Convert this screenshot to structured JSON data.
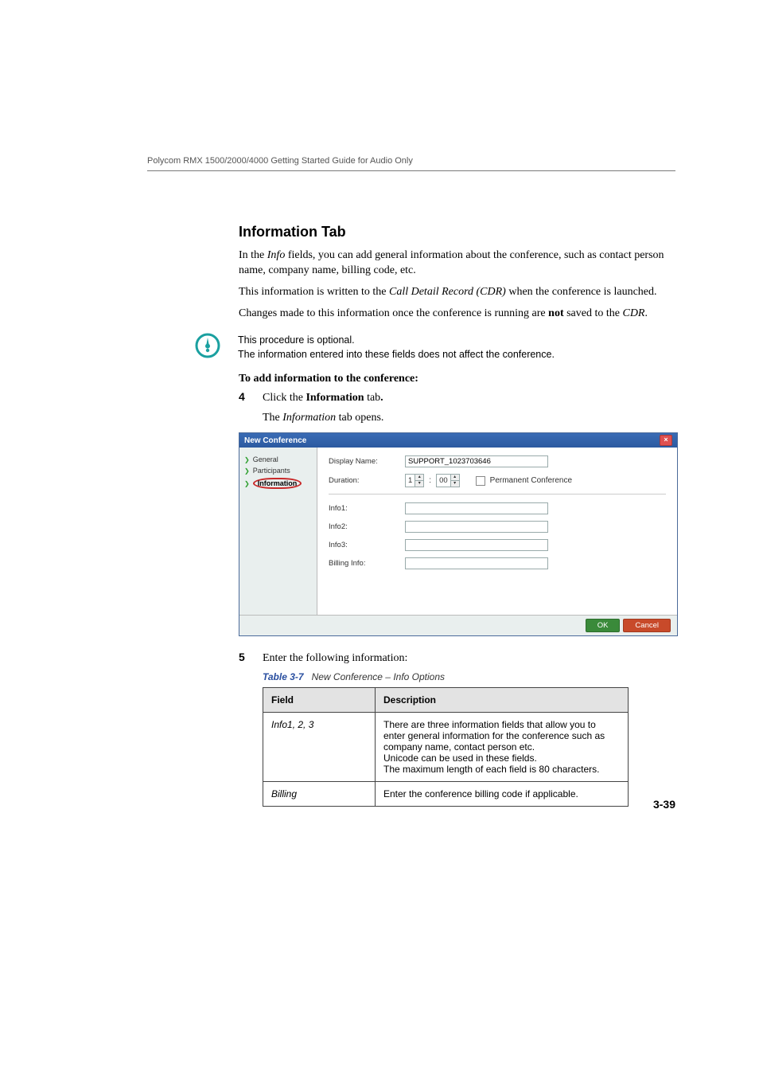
{
  "header": {
    "running": "Polycom RMX 1500/2000/4000 Getting Started Guide for Audio Only"
  },
  "section": {
    "title": "Information Tab"
  },
  "para": {
    "p1a": "In the ",
    "p1b": "Info",
    "p1c": " fields, you can add general information about the conference, such as contact person name, company name, billing code, etc.",
    "p2a": "This information is written to the ",
    "p2b": "Call Detail Record (CDR)",
    "p2c": " when the conference is launched.",
    "p3a": "Changes made to this information once the conference is running are ",
    "p3b": "not",
    "p3c": " saved to the ",
    "p3d": "CDR",
    "p3e": "."
  },
  "note": {
    "line1": "This procedure is optional.",
    "line2": "The information entered into these fields does not affect the conference."
  },
  "proc": {
    "heading": "To add information to the conference:"
  },
  "step4": {
    "num": "4",
    "a": "Click the ",
    "b": "Information",
    "c": " tab",
    "d": ".",
    "result_a": "The ",
    "result_b": "Information",
    "result_c": " tab opens."
  },
  "dialog": {
    "title": "New Conference",
    "nav": {
      "general": "General",
      "participants": "Participants",
      "information": "Information"
    },
    "labels": {
      "display_name": "Display Name:",
      "duration": "Duration:",
      "permanent": "Permanent Conference",
      "info1": "Info1:",
      "info2": "Info2:",
      "info3": "Info3:",
      "billing": "Billing Info:"
    },
    "values": {
      "display_name": "SUPPORT_1023703646",
      "dur_h": "1",
      "dur_m": "00"
    },
    "buttons": {
      "ok": "OK",
      "cancel": "Cancel"
    }
  },
  "step5": {
    "num": "5",
    "text": "Enter the following information:"
  },
  "table": {
    "num": "Table 3-7",
    "title": "New Conference – Info Options",
    "head_field": "Field",
    "head_desc": "Description",
    "row1": {
      "field": "Info1, 2, 3",
      "d1": "There are three information fields that allow you to enter general information for the conference such as company name, contact person etc.",
      "d2": "Unicode can be used in these fields.",
      "d3": "The maximum length of each field is 80 characters."
    },
    "row2": {
      "field": "Billing",
      "desc": "Enter the conference billing code if applicable."
    }
  },
  "page_number": "3-39"
}
